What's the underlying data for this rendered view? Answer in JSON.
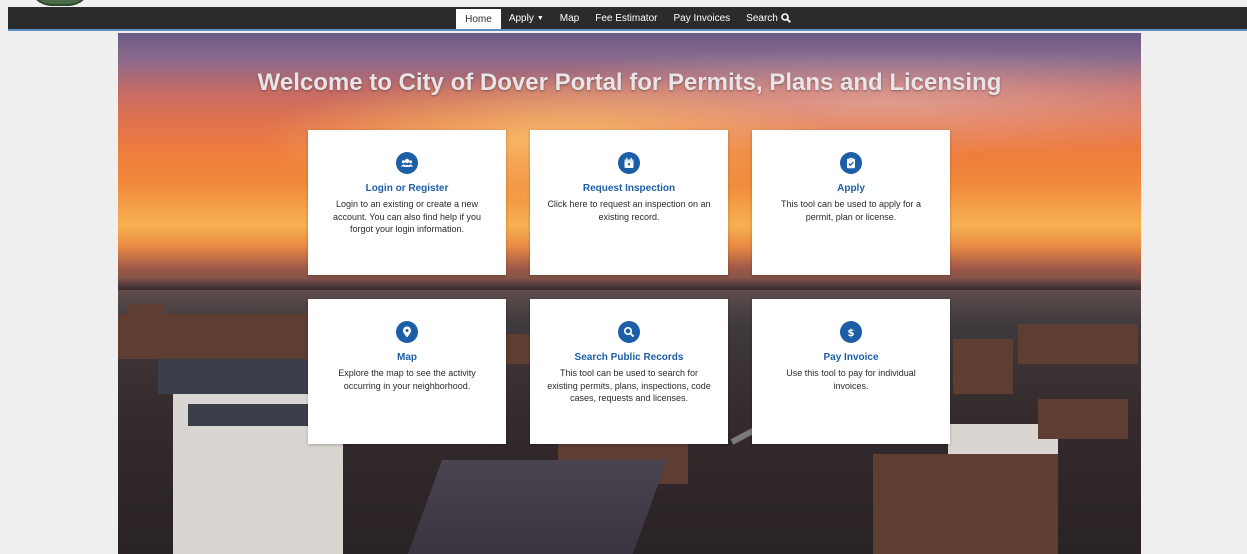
{
  "nav": {
    "items": [
      {
        "label": "Home",
        "active": true
      },
      {
        "label": "Apply",
        "active": false,
        "dropdown": true
      },
      {
        "label": "Map",
        "active": false
      },
      {
        "label": "Fee Estimator",
        "active": false
      },
      {
        "label": "Pay Invoices",
        "active": false
      },
      {
        "label": "Search",
        "active": false,
        "icon": "search-icon"
      }
    ]
  },
  "hero": {
    "title": "Welcome to City of Dover Portal for Permits, Plans and Licensing"
  },
  "cards": [
    {
      "title": "Login or Register",
      "desc": "Login to an existing or create a new account. You can also find help if you forgot your login information.",
      "icon": "users-icon"
    },
    {
      "title": "Request Inspection",
      "desc": "Click here to request an inspection on an existing record.",
      "icon": "calendar-icon"
    },
    {
      "title": "Apply",
      "desc": "This tool can be used to apply for a permit, plan or license.",
      "icon": "clipboard-check-icon"
    },
    {
      "title": "Map",
      "desc": "Explore the map to see the activity occurring in your neighborhood.",
      "icon": "map-marker-icon"
    },
    {
      "title": "Search Public Records",
      "desc": "This tool can be used to search for existing permits, plans, inspections, code cases, requests and licenses.",
      "icon": "search-icon"
    },
    {
      "title": "Pay Invoice",
      "desc": "Use this tool to pay for individual invoices.",
      "icon": "dollar-icon"
    }
  ],
  "colors": {
    "accent": "#1d5fa7",
    "navbar": "#2b2b2b",
    "nav_border": "#5b8fc2"
  }
}
